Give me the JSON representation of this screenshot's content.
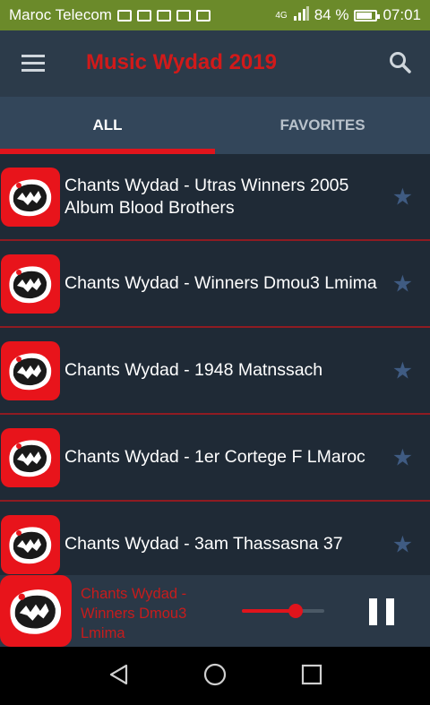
{
  "status_bar": {
    "carrier": "Maroc Telecom",
    "network": "4G",
    "battery": "84 %",
    "time": "07:01"
  },
  "app_bar": {
    "title": "Music Wydad 2019",
    "title_color": "#d11a1a"
  },
  "tabs": [
    {
      "label": "ALL",
      "active": true
    },
    {
      "label": "FAVORITES",
      "active": false
    }
  ],
  "songs": [
    {
      "title": "Chants Wydad - Utras Winners 2005 Album  Blood Brothers"
    },
    {
      "title": "Chants Wydad - Winners Dmou3 Lmima"
    },
    {
      "title": "Chants Wydad - 1948 Matnssach"
    },
    {
      "title": "Chants Wydad - 1er Cortege F LMaroc"
    },
    {
      "title": "Chants Wydad - 3am Thassasna 37"
    }
  ],
  "now_playing": {
    "title": "Chants Wydad - Winners Dmou3 Lmima",
    "progress": 0.65
  },
  "icons": {
    "menu": "menu-icon",
    "search": "search-icon",
    "favorite": "star-icon",
    "pause": "pause-icon",
    "back": "back-icon",
    "home": "home-icon",
    "recents": "recents-icon"
  },
  "colors": {
    "accent": "#e0141c",
    "background": "#1f2a36",
    "status_bar": "#6b8a2a"
  }
}
